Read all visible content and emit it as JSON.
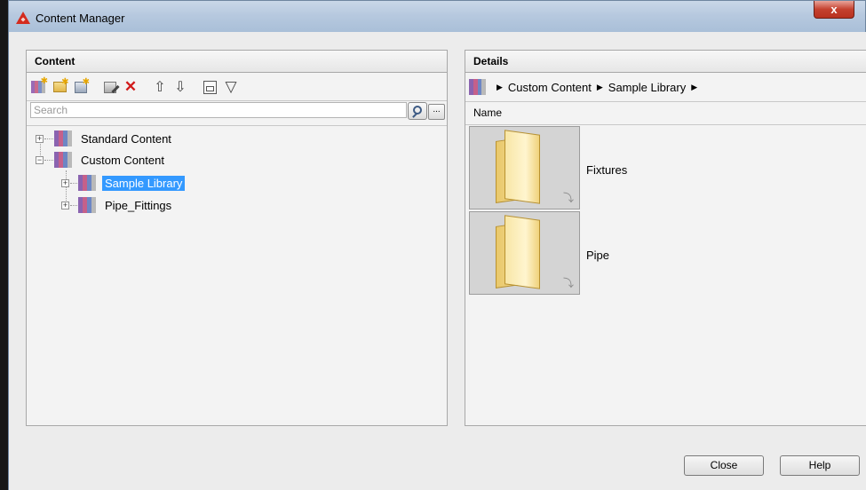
{
  "window": {
    "title": "Content Manager",
    "close_glyph": "x"
  },
  "content_panel": {
    "header": "Content",
    "toolbar_icons": [
      "new-library-icon",
      "new-folder-icon",
      "add-content-icon",
      "edit-icon",
      "delete-icon",
      "move-up-icon",
      "move-down-icon",
      "add-to-drawing-icon",
      "filter-icon"
    ],
    "search_placeholder": "Search",
    "more_button": "...",
    "tree": [
      {
        "label": "Standard Content",
        "expander": "+",
        "level": 0
      },
      {
        "label": "Custom Content",
        "expander": "−",
        "level": 0
      },
      {
        "label": "Sample Library",
        "expander": "+",
        "level": 1,
        "selected": true
      },
      {
        "label": "Pipe_Fittings",
        "expander": "+",
        "level": 1
      }
    ]
  },
  "details_panel": {
    "header": "Details",
    "breadcrumb": [
      "Custom Content",
      "Sample Library"
    ],
    "name_column": "Name",
    "items": [
      {
        "label": "Fixtures"
      },
      {
        "label": "Pipe"
      }
    ]
  },
  "buttons": {
    "close": "Close",
    "help": "Help"
  },
  "colors": {
    "selection": "#3399ff",
    "brand_red": "#d42b1e"
  }
}
